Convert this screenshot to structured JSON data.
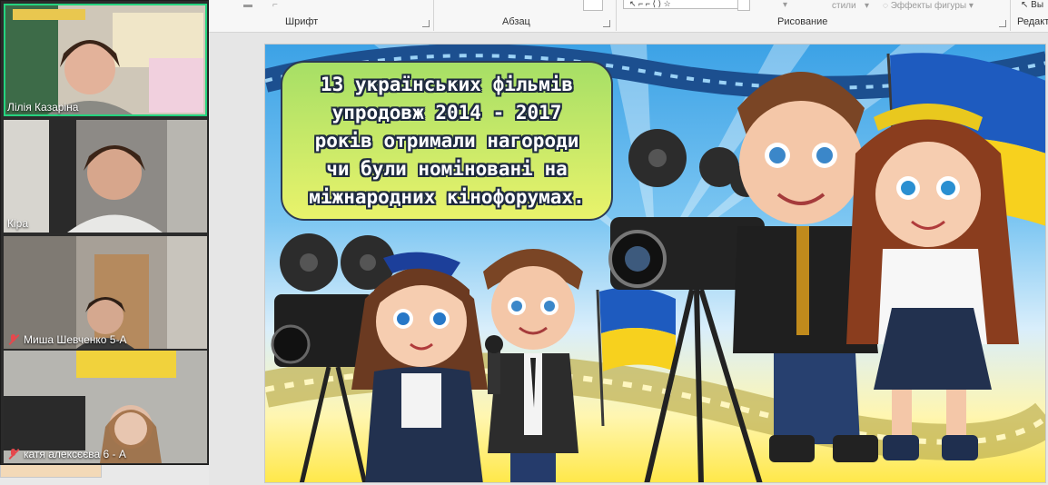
{
  "ribbon": {
    "groups": [
      {
        "label": "Шрифт"
      },
      {
        "label": "Абзац"
      },
      {
        "label": "Рисование"
      },
      {
        "label": "Редакт"
      }
    ],
    "shape_styles_label": "стили",
    "shape_effects_label": "Эффекты фигуры",
    "top_right_label": "Вы"
  },
  "slide": {
    "bubble_lines": [
      "13 українських фільмів",
      "упродовж 2014 - 2017",
      "років отримали нагороди",
      "чи були номіновані на",
      "міжнародних кінофорумах."
    ]
  },
  "participants": [
    {
      "name": "Лілія Казаріна",
      "muted": false,
      "active": true
    },
    {
      "name": "Кіра",
      "muted": false,
      "active": false
    },
    {
      "name": "Миша Шевченко 5-А",
      "muted": true,
      "active": false
    },
    {
      "name": "катя алексєєва 6 - А",
      "muted": true,
      "active": false
    }
  ],
  "colors": {
    "active_speaker": "#25d37f",
    "muted_icon": "#e5484d",
    "bubble_outline": "#2b3a55"
  }
}
